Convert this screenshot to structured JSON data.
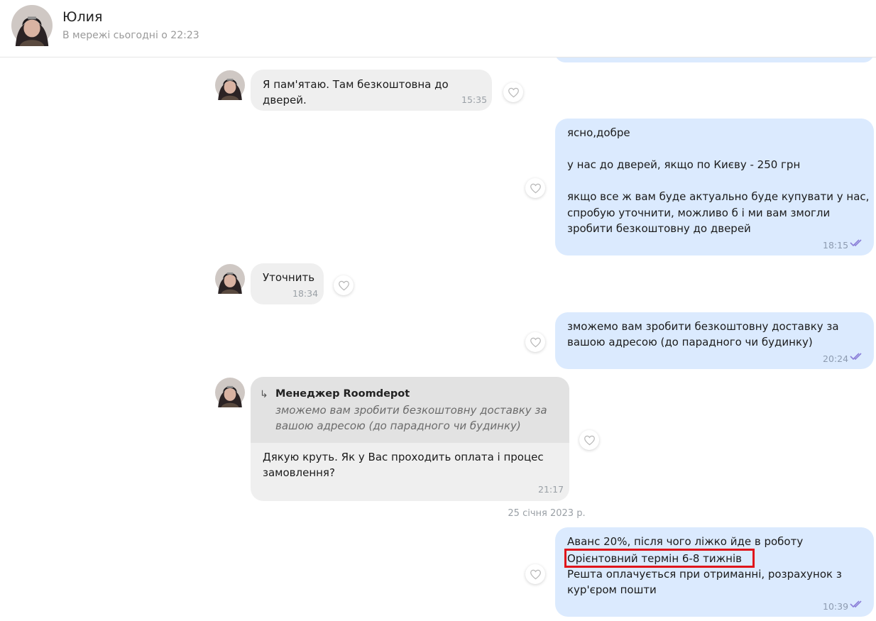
{
  "header": {
    "name": "Юлия",
    "status": "В мережі сьогодні о 22:23"
  },
  "messages": [
    {
      "text": "Я пам'ятаю. Там безкоштовна до дверей.",
      "time": "15:35"
    },
    {
      "text": "ясно,добре\n\nу нас до дверей, якщо по Києву - 250 грн\n\nякщо все ж вам буде актуально буде купувати у нас,\nспробую уточнити, можливо б і ми вам змогли\nзробити безкоштовну до дверей",
      "time": "18:15"
    },
    {
      "text": "Уточнить",
      "time": "18:34"
    },
    {
      "text": "зможемо вам зробити безкоштовну доставку за\nвашою адресою (до парадного чи будинку)",
      "time": "20:24"
    },
    {
      "quote_author": "Менеджер Roomdepot",
      "quote_text": "зможемо вам зробити безкоштовну доставку за\nвашою адресою (до парадного чи будинку)",
      "text": "Дякую круть. Як у Вас проходить оплата і процес\nзамовлення?",
      "time": "21:17"
    },
    {
      "line1": "Аванс 20%, після чого ліжко йде в роботу",
      "line2": "Орієнтовний термін 6-8 тижнів",
      "line3": "Решта оплачується при отриманні, розрахунок з\nкур'єром пошти",
      "time": "10:39"
    }
  ],
  "date_separator": "25 січня 2023 р.",
  "colors": {
    "incoming_bubble": "#efefef",
    "outgoing_bubble": "#dbeafe",
    "quote_background": "#e2e2e2",
    "read_ticks": "#8b7fd8",
    "highlight": "#e0151b"
  }
}
